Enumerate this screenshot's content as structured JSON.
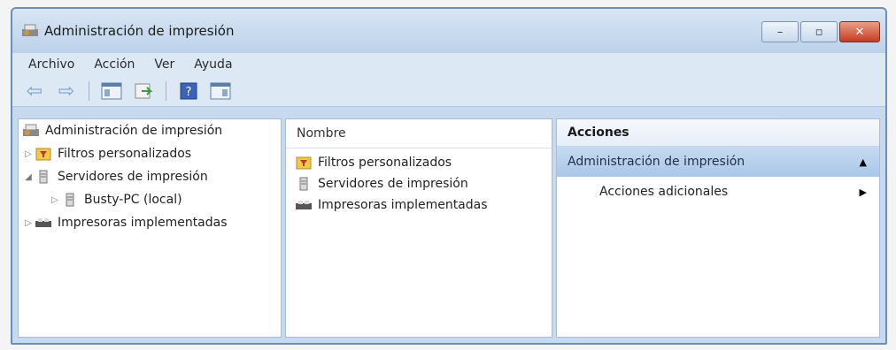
{
  "window": {
    "title": "Administración de impresión",
    "controls": {
      "minimize": "–",
      "restore": "▫",
      "close": "✕"
    }
  },
  "menu": [
    "Archivo",
    "Acción",
    "Ver",
    "Ayuda"
  ],
  "toolbar": {
    "icons": [
      "back-arrow-icon",
      "forward-arrow-icon",
      "show-hide-console-tree-icon",
      "export-list-icon",
      "help-icon",
      "show-hide-action-pane-icon"
    ]
  },
  "tree": {
    "root": "Administración de impresión",
    "items": [
      {
        "label": "Filtros personalizados",
        "expander": "▷"
      },
      {
        "label": "Servidores de impresión",
        "expander": "◢"
      },
      {
        "label": "Busty-PC (local)",
        "expander": "▷"
      },
      {
        "label": "Impresoras implementadas",
        "expander": "▷"
      }
    ]
  },
  "list": {
    "column": "Nombre",
    "rows": [
      "Filtros personalizados",
      "Servidores de impresión",
      "Impresoras implementadas"
    ]
  },
  "actions": {
    "header": "Acciones",
    "selected": "Administración de impresión",
    "selected_marker": "▲",
    "sub": "Acciones adicionales",
    "sub_marker": "▶"
  },
  "colors": {
    "accent": "#a9c6e7",
    "frame": "#6a8fb6",
    "close": "#c63b22"
  }
}
